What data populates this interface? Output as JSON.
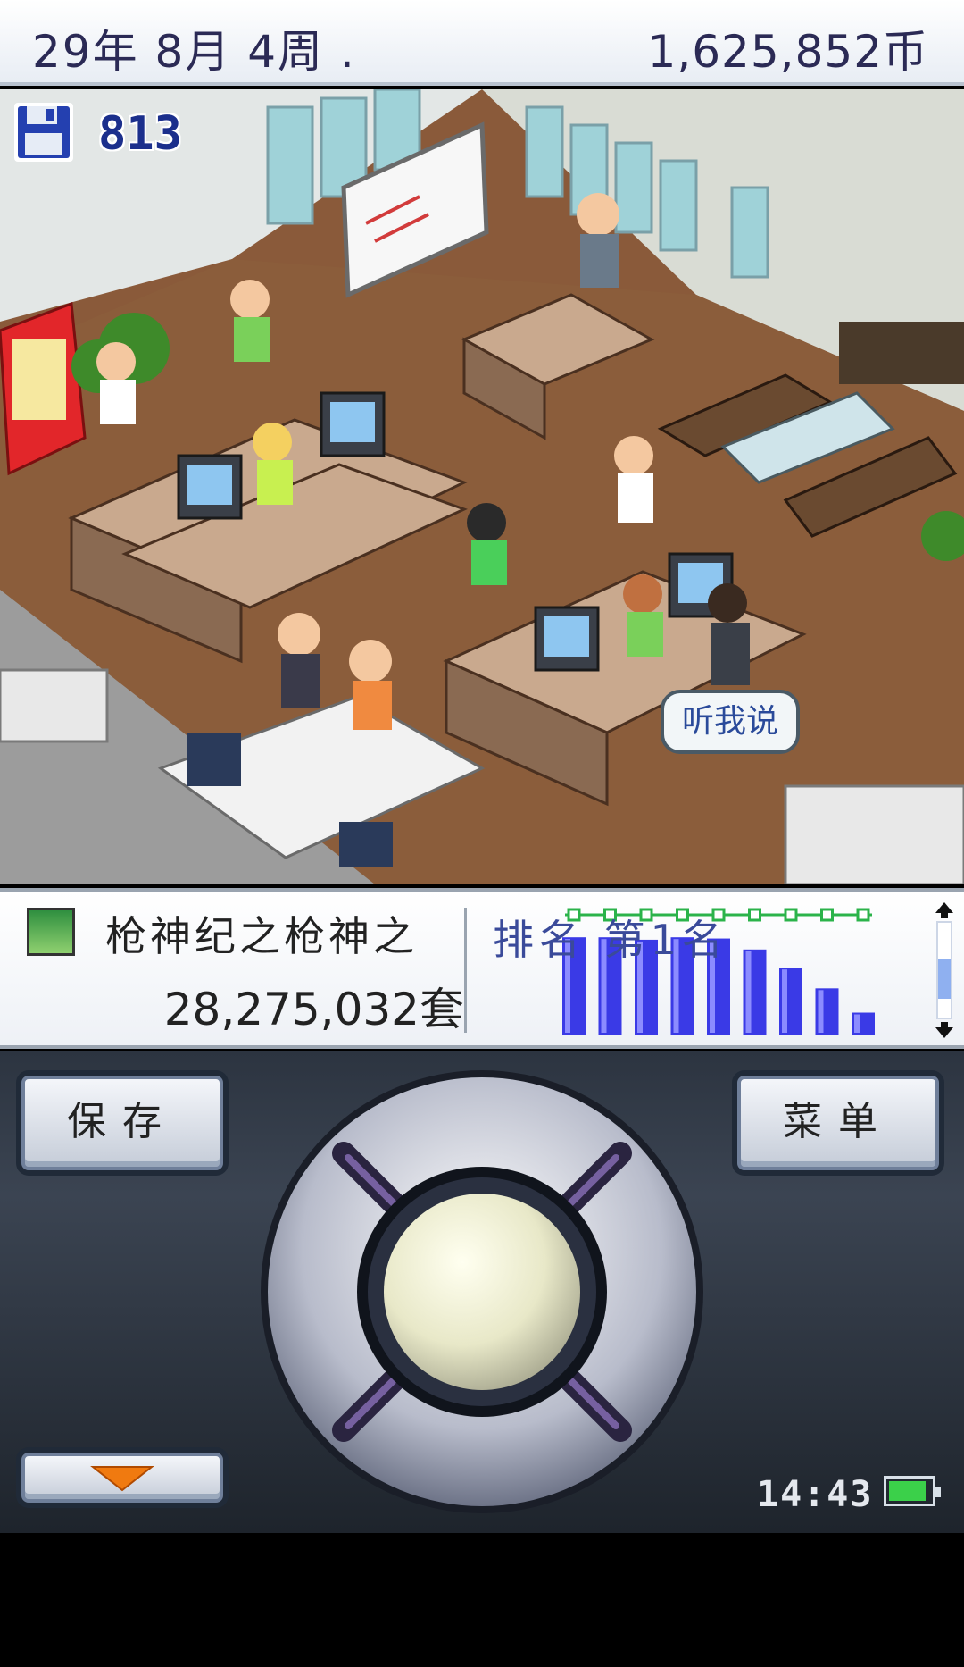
{
  "header": {
    "date": "29年 8月 4周 .",
    "money": "1,625,852币"
  },
  "scene": {
    "save_count": "813",
    "speech_bubble": "听我说"
  },
  "info": {
    "game_title": "枪神纪之枪神之",
    "sales": "28,275,032套",
    "rank_text": "排名 第1名"
  },
  "chart_data": {
    "type": "bar",
    "values": [
      80,
      80,
      78,
      80,
      79,
      70,
      55,
      38,
      18
    ]
  },
  "controls": {
    "save_label": "保存",
    "menu_label": "菜单",
    "clock": "14:43",
    "battery_level": 0.9
  },
  "colors": {
    "bar_fill": "#3a3ae6",
    "bar_highlight": "#8c8cff",
    "accent_dots": "#2bb34a",
    "text_dark": "#2b2a55"
  }
}
